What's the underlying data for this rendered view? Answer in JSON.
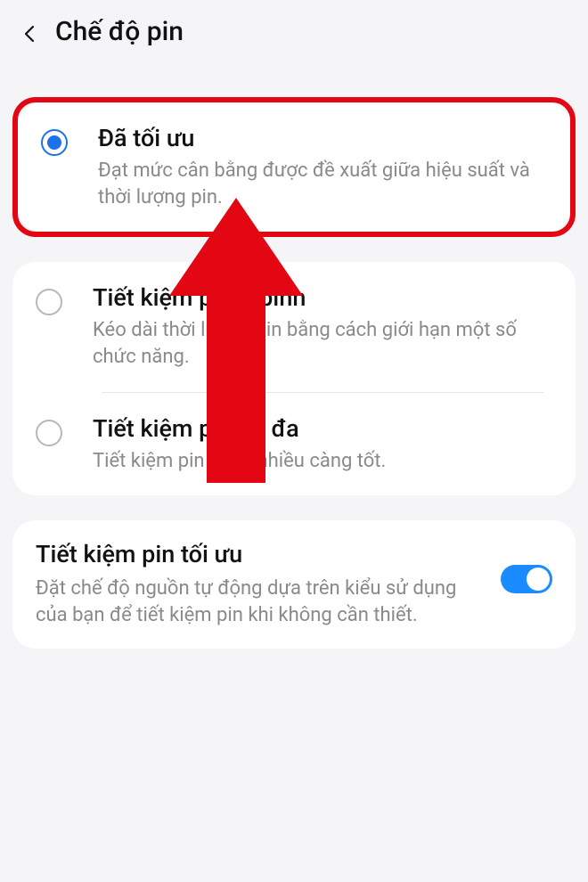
{
  "header": {
    "title": "Chế độ pin"
  },
  "options": [
    {
      "title": "Đã tối ưu",
      "desc": "Đạt mức cân bằng được đề xuất giữa hiệu suất và thời lượng pin."
    },
    {
      "title": "Tiết kiệm pin tr.bình",
      "desc": "Kéo dài thời lượng pin bằng cách giới hạn một số chức năng."
    },
    {
      "title": "Tiết kiệm pin tối đa",
      "desc": "Tiết kiệm pin càng nhiều càng tốt."
    }
  ],
  "adaptive": {
    "title": "Tiết kiệm pin tối ưu",
    "desc": "Đặt chế độ nguồn tự động dựa trên kiểu sử dụng của bạn để tiết kiệm pin khi không cần thiết."
  }
}
